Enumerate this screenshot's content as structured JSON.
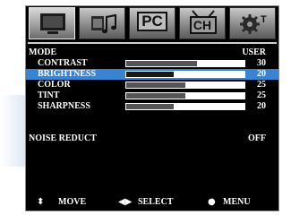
{
  "tabs": [
    {
      "name": "picture",
      "icon": "tv-icon",
      "label": ""
    },
    {
      "name": "sound",
      "icon": "music-notes-icon",
      "label": ""
    },
    {
      "name": "pc",
      "icon": "pc-icon",
      "label": "PC"
    },
    {
      "name": "channel",
      "icon": "channel-icon",
      "label": "CH"
    },
    {
      "name": "setup",
      "icon": "gear-icon",
      "label": ""
    }
  ],
  "mode": {
    "label": "MODE",
    "value": "USER"
  },
  "settings": [
    {
      "label": "CONTRAST",
      "value": "30",
      "level": 0.6
    },
    {
      "label": "BRIGHTNESS",
      "value": "20",
      "level": 0.4
    },
    {
      "label": "COLOR",
      "value": "25",
      "level": 0.5
    },
    {
      "label": "TINT",
      "value": "25",
      "level": 0.5
    },
    {
      "label": "SHARPNESS",
      "value": "20",
      "level": 0.4
    }
  ],
  "noise_reduct": {
    "label": "NOISE REDUCT",
    "value": "OFF"
  },
  "footer": {
    "move": {
      "label": "MOVE"
    },
    "select": {
      "label": "SELECT"
    },
    "menu": {
      "label": "MENU"
    }
  },
  "colors": {
    "highlight": "#3a83d2",
    "background": "#000000",
    "text": "#ffffff"
  }
}
